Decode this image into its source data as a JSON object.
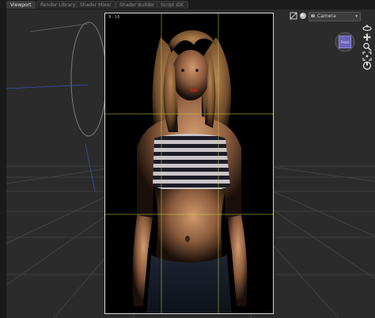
{
  "tabs": [
    {
      "label": "Viewport",
      "active": true
    },
    {
      "label": "Render Library",
      "active": false
    },
    {
      "label": "Shader Mixer",
      "active": false
    },
    {
      "label": "Shader Builder",
      "active": false
    },
    {
      "label": "Script IDE",
      "active": false
    }
  ],
  "viewport": {
    "frame_info": "9 : 16",
    "camera_select": "Camera",
    "viewcube_face": "Front"
  },
  "toolbar_icons": [
    "aspect-frame-icon",
    "draw-style-sphere-icon"
  ],
  "nav_icons": [
    "orbit-icon",
    "pan-icon",
    "zoom-icon",
    "frame-icon",
    "reset-camera-icon"
  ],
  "colors": {
    "background": "#2a2a2a",
    "frame_border": "#d9d9d9",
    "guide_lines": "#c8cc3a",
    "viewcube": "#6b62b9"
  }
}
